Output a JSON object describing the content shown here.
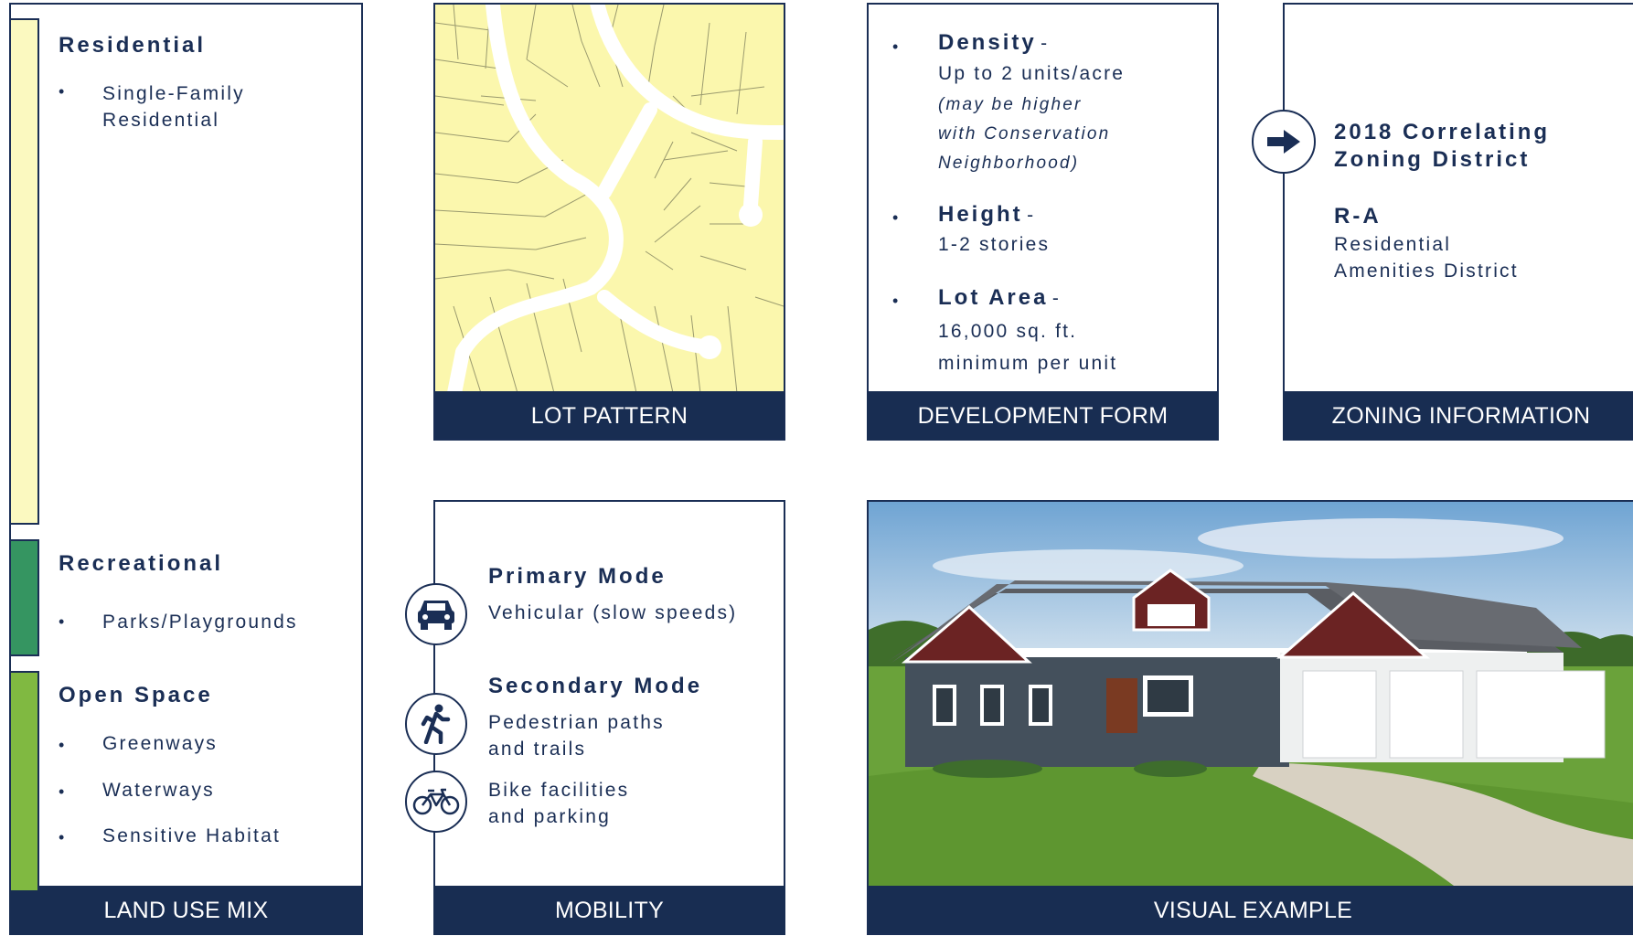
{
  "land_use": {
    "footer": "LAND USE MIX",
    "residential": {
      "title": "Residential",
      "items": [
        "Single-Family",
        "Residential"
      ]
    },
    "recreational": {
      "title": "Recreational",
      "items": [
        "Parks/Playgrounds"
      ]
    },
    "open_space": {
      "title": "Open Space",
      "items": [
        "Greenways",
        "Waterways",
        "Sensitive Habitat"
      ]
    },
    "colors": {
      "residential": "#fbf9c0",
      "recreational": "#359561",
      "open_space": "#80b941"
    }
  },
  "lot_pattern": {
    "footer": "LOT PATTERN",
    "colors": {
      "lot_fill": "#fbf7ad",
      "road": "#ffffff"
    }
  },
  "development_form": {
    "footer": "DEVELOPMENT FORM",
    "density": {
      "label": "Density",
      "dash": "-",
      "value": "Up to 2 units/acre",
      "note_lines": [
        "(may be higher",
        "with Conservation",
        "Neighborhood)"
      ]
    },
    "height": {
      "label": "Height",
      "dash": "-",
      "value": "1-2 stories"
    },
    "lot_area": {
      "label": "Lot Area",
      "dash": "-",
      "value_lines": [
        "16,000 sq. ft.",
        "minimum per unit"
      ]
    }
  },
  "zoning": {
    "footer": "ZONING INFORMATION",
    "title_lines": [
      "2018 Correlating",
      "Zoning District"
    ],
    "code": "R-A",
    "name_lines": [
      "Residential",
      "Amenities District"
    ],
    "icon": "arrow-right-icon"
  },
  "mobility": {
    "footer": "MOBILITY",
    "primary": {
      "title": "Primary Mode",
      "text": "Vehicular (slow speeds)",
      "icon": "car-icon"
    },
    "secondary": {
      "title": "Secondary Mode",
      "lines": [
        "Pedestrian paths",
        "and trails"
      ],
      "icon": "pedestrian-icon"
    },
    "bike": {
      "lines": [
        "Bike facilities",
        "and parking"
      ],
      "icon": "bicycle-icon"
    }
  },
  "visual_example": {
    "footer": "VISUAL EXAMPLE"
  },
  "brand": {
    "navy": "#182d52"
  }
}
